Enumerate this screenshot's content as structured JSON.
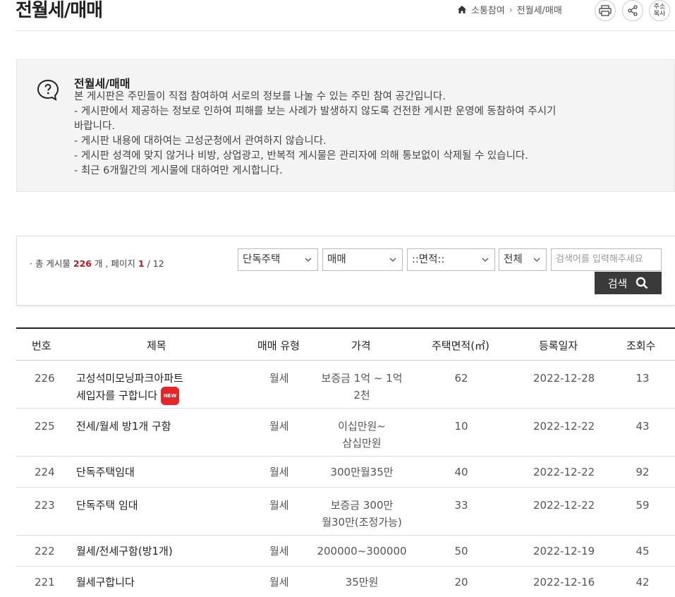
{
  "header": {
    "title": "전월세/매매",
    "breadcrumb": [
      "소통참여",
      "전월세/매매"
    ],
    "tools": {
      "copy_label_1": "주소",
      "copy_label_2": "복사"
    }
  },
  "notice": {
    "title": "전월세/매매",
    "lines": [
      "본 게시판은 주민들이 직접 참여하여 서로의 정보를 나눌 수 있는 주민 참여 공간입니다.",
      "- 게시판에서 제공하는 정보로 인하여 피해를 보는 사례가 발생하지 않도록 건전한 게시판 운영에 동참하여 주시기",
      "바랍니다.",
      "- 게시판 내용에 대하여는 고성군청에서 관여하지 않습니다.",
      "- 게시판 성격에 맞지 않거나 비방, 상업광고, 반복적 게시물은 관리자에 의해 통보없이 삭제될 수 있습니다.",
      "- 최근 6개월간의 게시물에 대하여만 게시합니다."
    ]
  },
  "search": {
    "count_prefix": "· 총 게시물",
    "total": "226",
    "count_mid": "개 , 페이지",
    "page": "1",
    "page_total": "/ 12",
    "selects": [
      "단독주택",
      "매매",
      "::면적::",
      "전체"
    ],
    "placeholder": "검색어를 입력해주세요",
    "button": "검색"
  },
  "table": {
    "headers": [
      "번호",
      "제목",
      "매매 유형",
      "가격",
      "주택면적(㎡)",
      "등록일자",
      "조회수"
    ],
    "new_badge": "NEW",
    "rows": [
      {
        "num": "226",
        "title1": "고성석미모닝파크아파트",
        "title2": "세입자를 구합니다",
        "type": "월세",
        "price1": "보증금 1억 ~ 1억",
        "price2": "2천",
        "area": "62",
        "date": "2022-12-28",
        "views": "13"
      },
      {
        "num": "225",
        "title1": "전세/월세 방1개 구함",
        "title2": "",
        "type": "월세",
        "price1": "이십만원~",
        "price2": "삼십만원",
        "area": "10",
        "date": "2022-12-22",
        "views": "43"
      },
      {
        "num": "224",
        "title1": "단독주택임대",
        "title2": "",
        "type": "월세",
        "price1": "300만월35만",
        "price2": "",
        "area": "40",
        "date": "2022-12-22",
        "views": "92"
      },
      {
        "num": "223",
        "title1": "단독주택 임대",
        "title2": "",
        "type": "월세",
        "price1": "보증금 300만",
        "price2": "월30만(조정가능)",
        "area": "33",
        "date": "2022-12-22",
        "views": "59"
      },
      {
        "num": "222",
        "title1": "월세/전세구함(방1개)",
        "title2": "",
        "type": "월세",
        "price1": "200000~300000",
        "price2": "",
        "area": "50",
        "date": "2022-12-19",
        "views": "45"
      },
      {
        "num": "221",
        "title1": "월세구합니다",
        "title2": "",
        "type": "월세",
        "price1": "35만원",
        "price2": "",
        "area": "20",
        "date": "2022-12-16",
        "views": "42"
      }
    ]
  }
}
